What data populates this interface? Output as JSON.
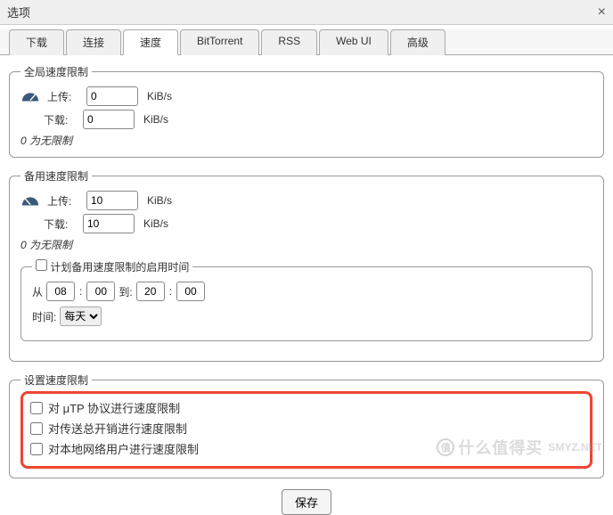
{
  "window": {
    "title": "选项",
    "close": "×"
  },
  "tabs": [
    "下载",
    "连接",
    "速度",
    "BitTorrent",
    "RSS",
    "Web UI",
    "高级"
  ],
  "active_tab": 2,
  "global": {
    "legend": "全局速度限制",
    "upload_label": "上传:",
    "upload_value": "0",
    "download_label": "下载:",
    "download_value": "0",
    "unit": "KiB/s",
    "hint": "0 为无限制"
  },
  "alt": {
    "legend": "备用速度限制",
    "upload_label": "上传:",
    "upload_value": "10",
    "download_label": "下载:",
    "download_value": "10",
    "unit": "KiB/s",
    "hint": "0 为无限制",
    "schedule": {
      "checkbox_label": "计划备用速度限制的启用时间",
      "from_label": "从",
      "from_h": "08",
      "from_m": "00",
      "to_label": "到:",
      "to_h": "20",
      "to_m": "00",
      "when_label": "时间:",
      "days": "每天"
    }
  },
  "rate_settings": {
    "legend": "设置速度限制",
    "utp": "对 μTP 协议进行速度限制",
    "overhead": "对传送总开销进行速度限制",
    "lan": "对本地网络用户进行速度限制"
  },
  "save": "保存",
  "watermark": {
    "logo": "值",
    "zh": "什么值得买",
    "en": "SMYZ.NET"
  }
}
